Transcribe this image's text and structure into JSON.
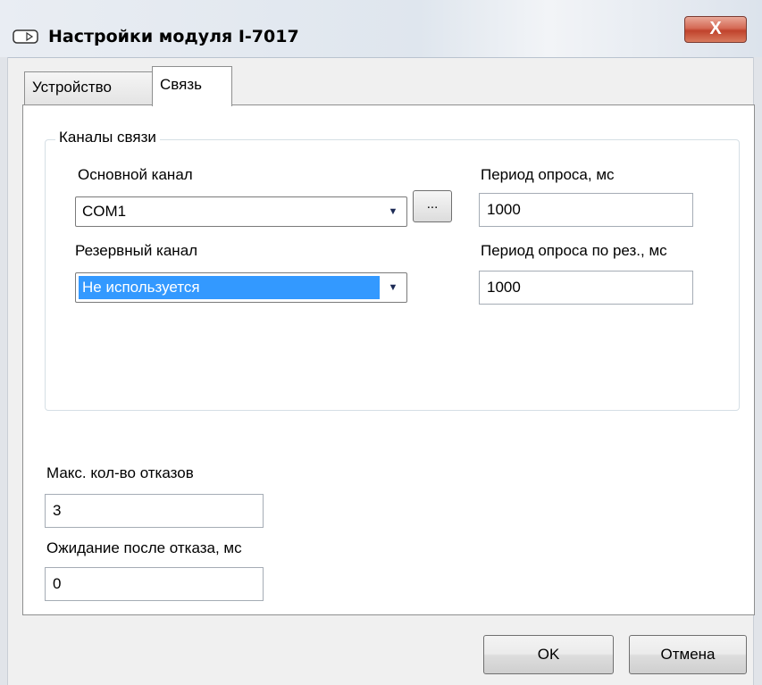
{
  "window": {
    "title": "Настройки модуля I-7017",
    "close_label": "X"
  },
  "tabs": [
    {
      "label": "Устройство",
      "selected": false
    },
    {
      "label": "Связь",
      "selected": true
    }
  ],
  "channels": {
    "legend": "Каналы связи",
    "primary_label": "Основной канал",
    "primary_value": "COM1",
    "browse_label": "...",
    "backup_label": "Резервный канал",
    "backup_value": "Не используется",
    "poll_label": "Период опроса, мс",
    "poll_value": "1000",
    "backup_poll_label": "Период опроса по рез., мс",
    "backup_poll_value": "1000"
  },
  "failures": {
    "max_label": "Макс. кол-во отказов",
    "max_value": "3",
    "wait_label": "Ожидание после отказа, мс",
    "wait_value": "0"
  },
  "buttons": {
    "ok": "OK",
    "cancel": "Отмена"
  }
}
